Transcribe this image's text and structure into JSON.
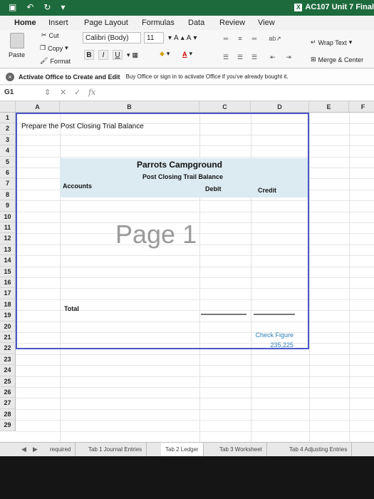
{
  "titlebar": {
    "save_glyph": "▣",
    "undo_glyph": "↶",
    "redo_glyph": "↻",
    "more_glyph": "▾",
    "excel_glyph": "X",
    "title": "AC107 Unit 7 Final"
  },
  "tabs": [
    "Home",
    "Insert",
    "Page Layout",
    "Formulas",
    "Data",
    "Review",
    "View"
  ],
  "ribbon": {
    "cut": "Cut",
    "copy": "Copy",
    "format": "Format",
    "paste": "Paste",
    "font": "Calibri (Body)",
    "size": "11",
    "grow_font": "A",
    "shrink_font": "A",
    "bold": "B",
    "italic": "I",
    "underline": "U",
    "font_color": "A",
    "wrap_text": "Wrap Text",
    "merge_center": "Merge & Center"
  },
  "message": {
    "icon": "×",
    "title": "Activate Office to Create and Edit",
    "text": "Buy Office or sign in to activate Office if you've already bought it."
  },
  "formula": {
    "cell_ref": "G1",
    "cancel": "✕",
    "confirm": "✓",
    "fx": "fx"
  },
  "columns": [
    "A",
    "B",
    "C",
    "D",
    "E",
    "F"
  ],
  "rows": [
    "1",
    "2",
    "3",
    "4",
    "5",
    "6",
    "7",
    "8",
    "9",
    "10",
    "11",
    "12",
    "13",
    "14",
    "15",
    "16",
    "17",
    "18",
    "19",
    "20",
    "21",
    "22",
    "23",
    "24",
    "25",
    "26",
    "27",
    "28",
    "29"
  ],
  "cells": {
    "a1": "Prepare the Post Closing Trial Balance",
    "company": "Parrots Campground",
    "report": "Post Closing Trail Balance",
    "accounts": "Accounts",
    "debit": "Debit",
    "credit": "Credit",
    "total": "Total",
    "check_label": "Check Figure",
    "check_value": "235,225"
  },
  "watermark": "Page 1",
  "sheet_tabs": [
    "required",
    "Tab 1 Journal Entries",
    "Tab 2 Ledger",
    "Tab 3 Worksheet",
    "Tab 4 Adjusting Entries"
  ],
  "sheet_nav": {
    "prev": "◀",
    "next": "▶"
  }
}
